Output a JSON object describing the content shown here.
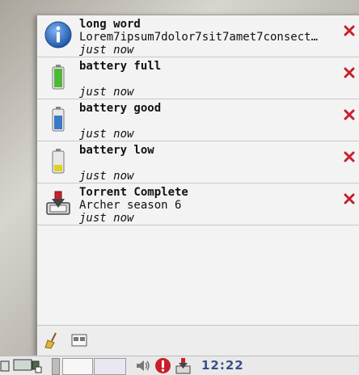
{
  "notifications": [
    {
      "title": "long word",
      "body": "Lorem7ipsum7dolor7sit7amet7consect…",
      "time": "just now",
      "icon": "info-icon"
    },
    {
      "title": "battery full",
      "body": "",
      "time": "just now",
      "icon": "battery-full-icon"
    },
    {
      "title": "battery good",
      "body": "",
      "time": "just now",
      "icon": "battery-good-icon"
    },
    {
      "title": "battery low",
      "body": "",
      "time": "just now",
      "icon": "battery-low-icon"
    },
    {
      "title": "Torrent Complete",
      "body": "Archer season 6",
      "time": "just now",
      "icon": "torrent-download-icon"
    }
  ],
  "toolbar": {
    "icons": [
      "broom-clear-icon",
      "window-switch-icon"
    ]
  },
  "taskbar": {
    "clock": "12:22",
    "icons": [
      "show-desktop-icon",
      "window-list-icon",
      "pager-icon",
      "volume-icon",
      "alert-icon",
      "torrent-tray-icon"
    ]
  },
  "colors": {
    "close_red": "#c8202a",
    "info_blue": "#2a63b8",
    "clock_blue": "#38508c",
    "battery_green": "#4fb83a",
    "battery_blue": "#3b78c8",
    "battery_yellow": "#e0d020"
  }
}
